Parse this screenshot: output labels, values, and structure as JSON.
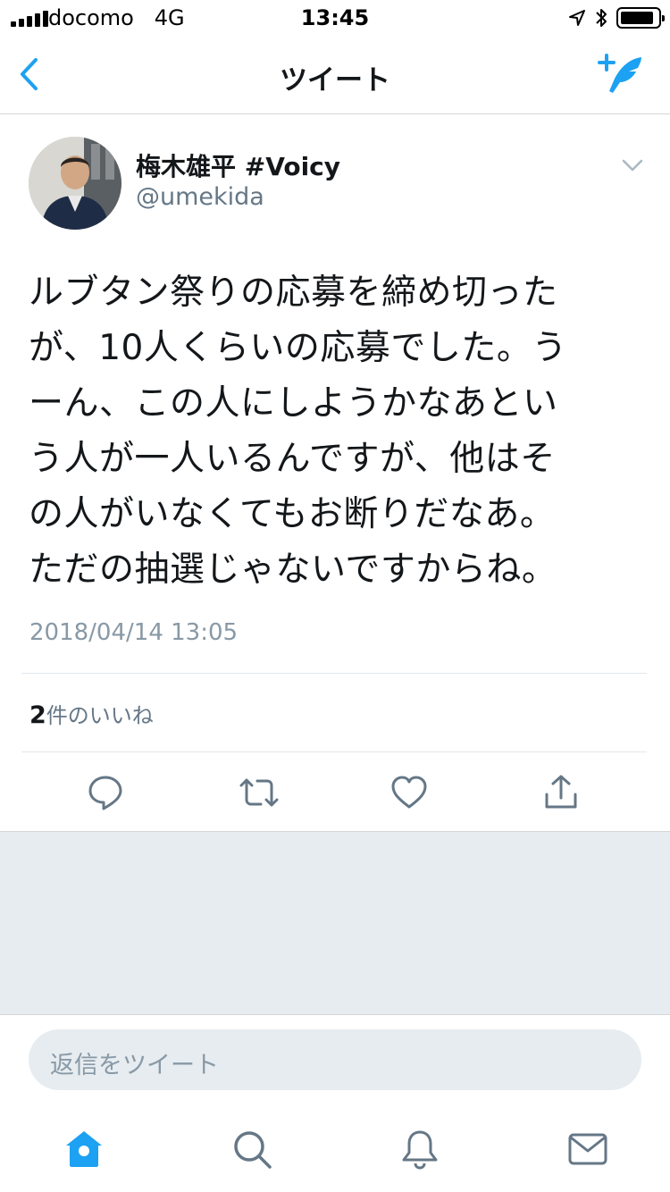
{
  "status_bar": {
    "carrier": "docomo",
    "network": "4G",
    "time": "13:45",
    "battery_percent": 90
  },
  "nav": {
    "title": "ツイート",
    "back_icon": "chevron-left-icon",
    "compose_icon": "compose-tweet-icon"
  },
  "tweet": {
    "author_name": "梅木雄平 #Voicy",
    "handle": "@umekida",
    "text_lines": [
      "ルブタン祭りの応募を締め切った",
      "が、10人くらいの応募でした。う",
      "ーん、この人にしようかなあとい",
      "う人が一人いるんですが、他はそ",
      "の人がいなくてもお断りだなあ。",
      "ただの抽選じゃないですからね。"
    ],
    "timestamp": "2018/04/14 13:05",
    "likes_count": "2",
    "likes_label": "件のいいね"
  },
  "actions": [
    {
      "name": "reply-icon"
    },
    {
      "name": "retweet-icon"
    },
    {
      "name": "like-icon"
    },
    {
      "name": "share-icon"
    }
  ],
  "reply": {
    "placeholder": "返信をツイート"
  },
  "tab_bar": [
    {
      "name": "home-icon",
      "active": true
    },
    {
      "name": "search-icon",
      "active": false
    },
    {
      "name": "notifications-icon",
      "active": false
    },
    {
      "name": "messages-icon",
      "active": false
    }
  ],
  "colors": {
    "accent": "#1da1f2",
    "icon_grey": "#657786",
    "muted_text": "#8899a6",
    "background_grey": "#e6ecf0"
  }
}
